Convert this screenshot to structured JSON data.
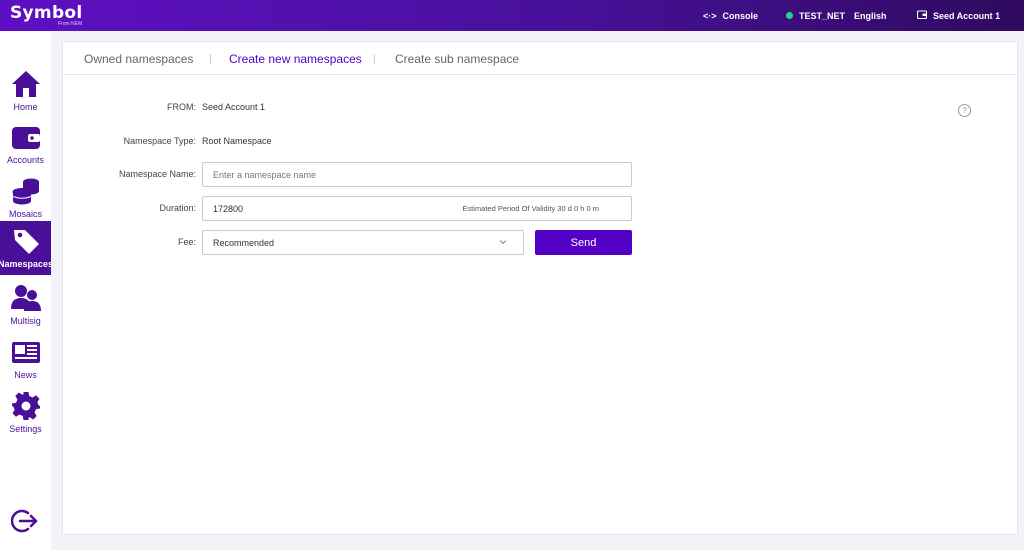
{
  "app": {
    "logo": "Symbol",
    "logo_sub": "From NEM"
  },
  "topbar": {
    "console": "Console",
    "network": "TEST_NET",
    "language": "English",
    "account": "Seed Account 1"
  },
  "sidebar": {
    "items": [
      {
        "label": "Home",
        "icon": "home-icon"
      },
      {
        "label": "Accounts",
        "icon": "wallet-icon"
      },
      {
        "label": "Mosaics",
        "icon": "coins-icon"
      },
      {
        "label": "Namespaces",
        "icon": "tag-icon",
        "active": true
      },
      {
        "label": "Multisig",
        "icon": "users-icon"
      },
      {
        "label": "News",
        "icon": "newspaper-icon"
      },
      {
        "label": "Settings",
        "icon": "gear-icon"
      }
    ],
    "logout_icon": "logout-icon"
  },
  "tabs": [
    {
      "label": "Owned namespaces"
    },
    {
      "label": "Create new namespaces",
      "active": true
    },
    {
      "label": "Create sub namespace"
    }
  ],
  "form": {
    "from_label": "FROM:",
    "from_value": "Seed Account 1",
    "type_label": "Namespace Type:",
    "type_value": "Root Namespace",
    "name_label": "Namespace Name:",
    "name_placeholder": "Enter a namespace name",
    "duration_label": "Duration:",
    "duration_value": "172800",
    "validity_text": "Estimated Period Of Validity 30 d 0 h 0 m",
    "fee_label": "Fee:",
    "fee_value": "Recommended",
    "send_label": "Send",
    "help_glyph": "?"
  },
  "colors": {
    "accent": "#5200c6",
    "sidebar_active": "#4a0f99",
    "network_dot": "#1fd58a"
  }
}
